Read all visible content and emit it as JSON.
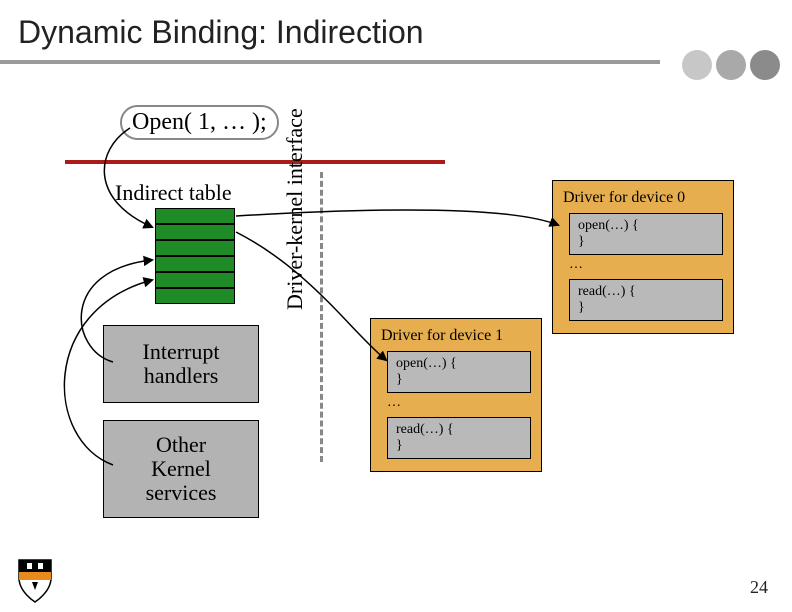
{
  "title": "Dynamic Binding: Indirection",
  "open_call": "Open( 1, … );",
  "indirect_table_label": "Indirect table",
  "interrupt_handlers": "Interrupt\nhandlers",
  "other_kernel": "Other\nKernel\nservices",
  "interface_label": "Driver-kernel interface",
  "driver0": {
    "header": "Driver for device 0",
    "open": "open(…) {\n}",
    "ellipsis": "…",
    "read": "read(…) {\n}"
  },
  "driver1": {
    "header": "Driver for device 1",
    "open": "open(…) {\n}",
    "ellipsis": "…",
    "read": "read(…) {\n}"
  },
  "page_number": "24"
}
